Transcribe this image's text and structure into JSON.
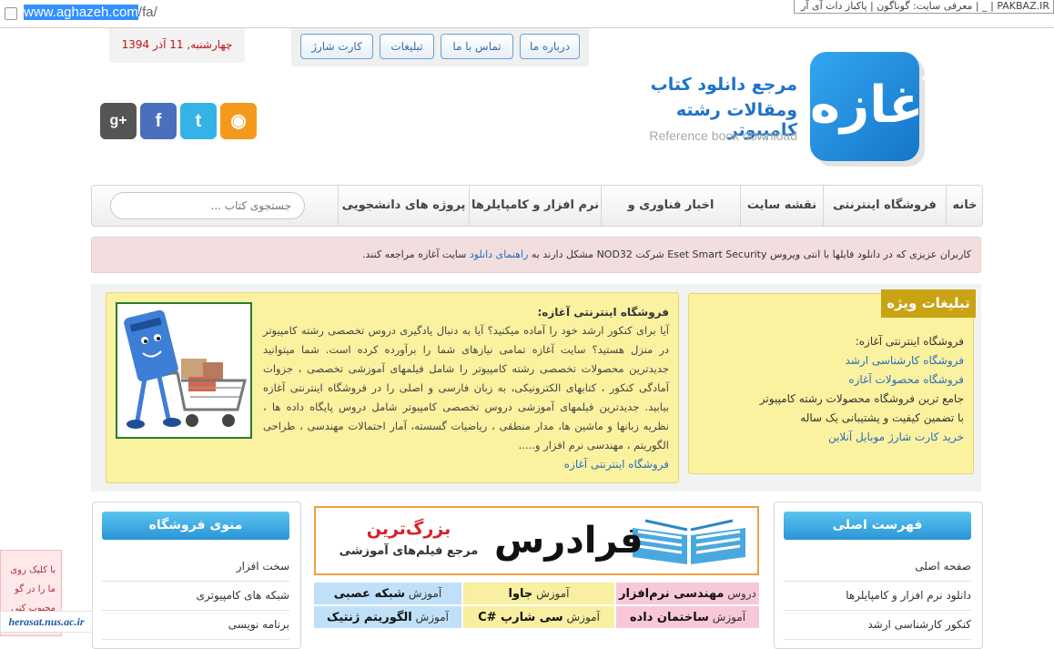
{
  "browser": {
    "url_selected": "www.aghazeh.com",
    "url_rest": "/fa/",
    "tab_title": "PAKBAZ.IR | _ | معرفی سایت: گوناگون | پاکباز دات آی آر"
  },
  "header": {
    "date": "چهارشنبه, 11 آذر 1394",
    "top_nav": [
      "درباره ما",
      "تماس با ما",
      "تبلیغات",
      "کارت شارژ"
    ],
    "logo_glyph": "آغازه",
    "tagline_1": "مرجع دانلود کتاب",
    "tagline_2": "ومقالات رشته کامپیوتر",
    "tagline_en": "Reference book download",
    "social": [
      {
        "name": "rss-icon",
        "glyph": "◉",
        "color": "#f39a1c"
      },
      {
        "name": "twitter-icon",
        "glyph": "t",
        "color": "#35b3e8"
      },
      {
        "name": "facebook-icon",
        "glyph": "f",
        "color": "#4a6fbc"
      },
      {
        "name": "google-plus-icon",
        "glyph": "g+",
        "color": "#555555"
      }
    ]
  },
  "main_nav": {
    "items": [
      "خانه",
      "فروشگاه اینترنتی",
      "نقشه سایت",
      "اخبار فناوری و اطلاعات",
      "نرم افزار و کامپایلرها",
      "پروژه های دانشجویی"
    ],
    "search_placeholder": "جستجوی کتاب ..."
  },
  "notice": {
    "before": "کاربران عزیزی که در دانلود فایلها با انتی ویروس Eset Smart Security شرکت NOD32 مشکل دارند به",
    "link": "راهنمای دانلود",
    "after": "سایت آغازه مراجعه کنند."
  },
  "ads": {
    "heading": "تبلیغات ویژه",
    "lines": [
      {
        "text": "فروشگاه اینترنتی آغازه:",
        "color": "#333333"
      },
      {
        "text": "فروشگاه کارشناسی ارشد",
        "color": "#2a6ebb"
      },
      {
        "text": "فروشگاه محصولات آغازه",
        "color": "#2a6ebb"
      },
      {
        "text": "جامع ترین فروشگاه محصولات رشته کامپیوتر",
        "color": "#333333"
      },
      {
        "text": "با تضمین کیفیت و پشتیبانی یک ساله",
        "color": "#333333"
      },
      {
        "text": "خرید کارت شارژ موبایل آنلاین",
        "color": "#2a6ebb"
      }
    ]
  },
  "shop": {
    "title": "فروشگاه اینترنتی آغازه:",
    "body": "آیا برای کنکور ارشد خود را آماده میکنید؟ آیا به دنبال یادگیری دروس تخصصی رشته کامپیوتر در منزل هستید؟ سایت آغازه تمامی نیازهای شما را برآورده کرده است. شما میتوانید جدیدترین محصولات تخصصی رشته کامپیوتر را شامل فیلمهای آموزشی تخصصی ، جزوات آمادگی کنکور ، کتابهای الکترونیکی، به زبان فارسی و اصلی را در فروشگاه اینترنتی آغازه بیابید. جدیدترین فیلمهای آموزشی دروس تخصصی کامپیوتر شامل دروس پایگاه داده ها ، نظریه زبانها و ماشین ها، مدار منطقی ، ریاضیات گسسته، آمار احتمالات مهندسی ، طراحی الگوریتم ، مهندسی نرم افزار و.....",
    "link": "فروشگاه اینترنتی آغازه"
  },
  "shop_menu": {
    "heading": "منوی فروشگاه",
    "items": [
      "سخت افزار",
      "شبکه های کامپیوتری",
      "برنامه نویسی"
    ]
  },
  "main_menu": {
    "heading": "فهرست اصلی",
    "items": [
      "صفحه اصلی",
      "دانلود نرم افزار و کامپایلرها",
      "کنکور کارشناسی ارشد"
    ]
  },
  "banner": {
    "brand": "فرادرس",
    "line1": "بزرگ‌ترین",
    "line2": "مرجع فیلم‌های آموزشی"
  },
  "courses": [
    {
      "pre": "دروس",
      "bold": "مهندسی نرم‌افزار",
      "bg": "#f8c8d8"
    },
    {
      "pre": "آموزش",
      "bold": "جاوا",
      "bg": "#f8f0a0"
    },
    {
      "pre": "آموزش",
      "bold": "شبکه عصبی",
      "bg": "#bfe0f8"
    },
    {
      "pre": "آموزش",
      "bold": "ساختمان داده",
      "bg": "#f8c8d8"
    },
    {
      "pre": "آموزش",
      "bold": "سی شارپ #C",
      "bg": "#f8f0a0"
    },
    {
      "pre": "آموزش",
      "bold": "الگوریتم ژنتیک",
      "bg": "#bfe0f8"
    }
  ],
  "overlay": {
    "lines": [
      "با کلیک روی",
      "ما را در گو",
      "محبوب کنی"
    ],
    "watermark": "herasat.nus.ac.ir"
  }
}
